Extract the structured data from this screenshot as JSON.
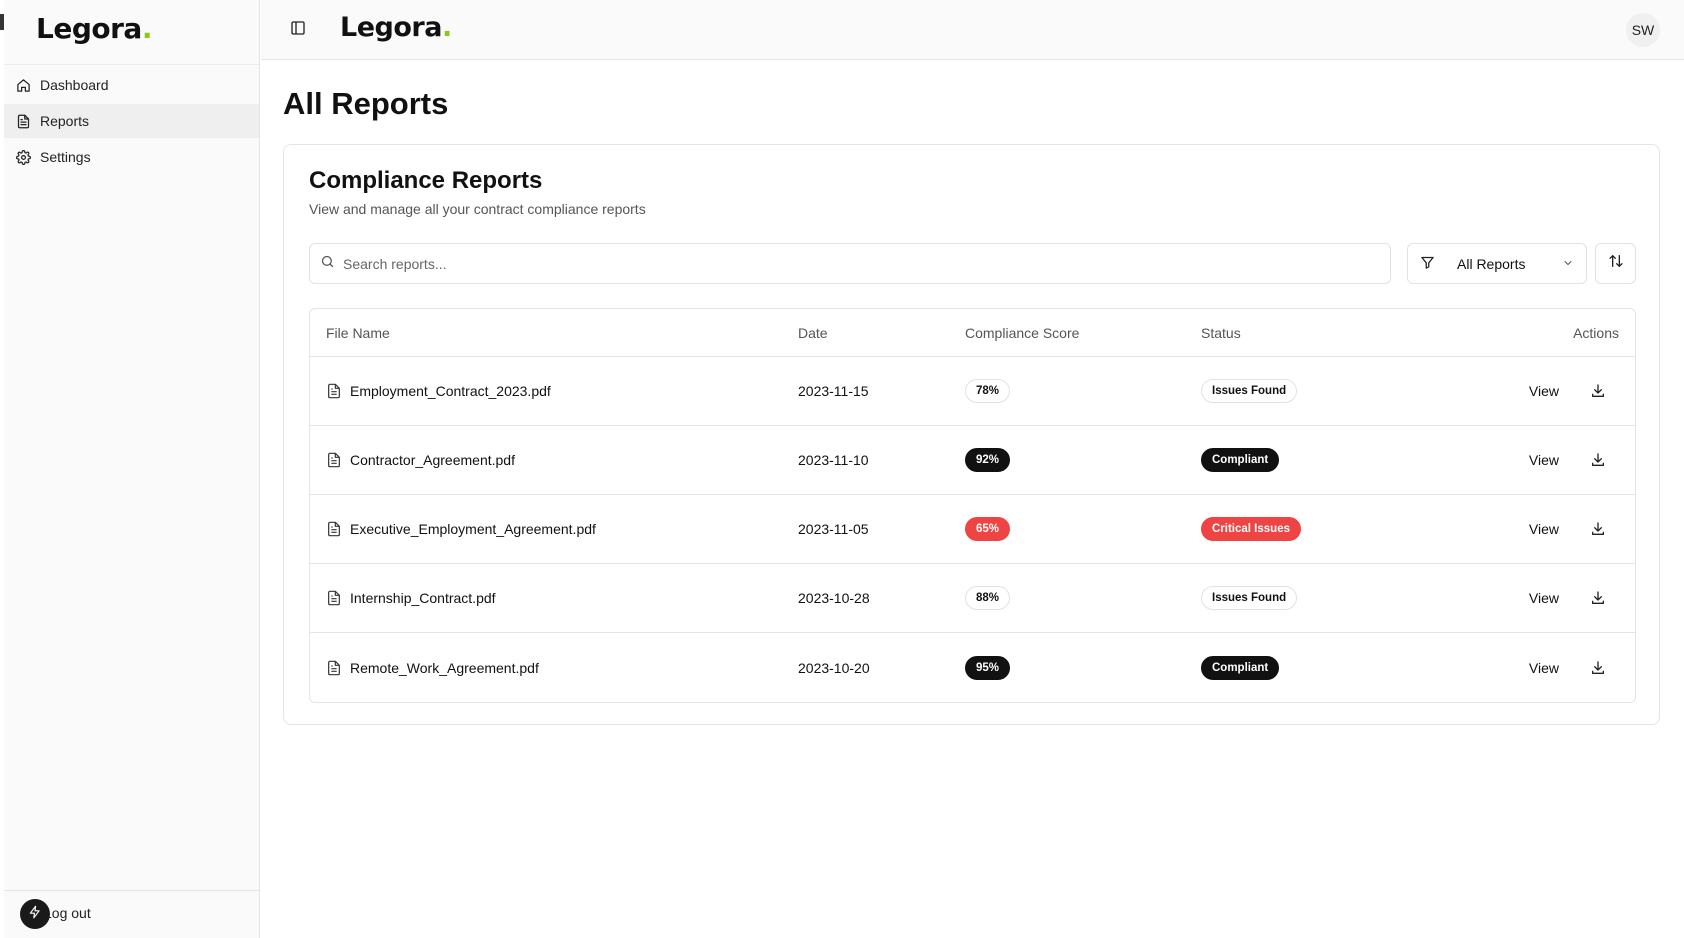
{
  "brand": {
    "name": "Legora",
    "dot": ".",
    "accent": "#84cc16"
  },
  "sidebar": {
    "items": [
      {
        "label": "Dashboard",
        "icon": "home-icon"
      },
      {
        "label": "Reports",
        "icon": "file-text-icon",
        "active": true
      },
      {
        "label": "Settings",
        "icon": "gear-icon"
      }
    ],
    "logout": "Log out"
  },
  "topbar": {
    "avatar": "SW"
  },
  "page": {
    "title": "All Reports"
  },
  "card": {
    "title": "Compliance Reports",
    "subtitle": "View and manage all your contract compliance reports"
  },
  "search": {
    "placeholder": "Search reports...",
    "value": ""
  },
  "filter": {
    "selected": "All Reports"
  },
  "table": {
    "headers": [
      "File Name",
      "Date",
      "Compliance Score",
      "Status",
      "Actions"
    ],
    "rows": [
      {
        "file": "Employment_Contract_2023.pdf",
        "date": "2023-11-15",
        "score": "78%",
        "score_style": "outline",
        "status": "Issues Found",
        "status_style": "outline",
        "action": "View"
      },
      {
        "file": "Contractor_Agreement.pdf",
        "date": "2023-11-10",
        "score": "92%",
        "score_style": "dark",
        "status": "Compliant",
        "status_style": "dark",
        "action": "View"
      },
      {
        "file": "Executive_Employment_Agreement.pdf",
        "date": "2023-11-05",
        "score": "65%",
        "score_style": "red",
        "status": "Critical Issues",
        "status_style": "red",
        "action": "View"
      },
      {
        "file": "Internship_Contract.pdf",
        "date": "2023-10-28",
        "score": "88%",
        "score_style": "outline",
        "status": "Issues Found",
        "status_style": "outline",
        "action": "View"
      },
      {
        "file": "Remote_Work_Agreement.pdf",
        "date": "2023-10-20",
        "score": "95%",
        "score_style": "dark",
        "status": "Compliant",
        "status_style": "dark",
        "action": "View"
      }
    ]
  },
  "colors": {
    "critical": "#ef4444",
    "dark_badge": "#111111",
    "border": "#e4e4e4"
  }
}
